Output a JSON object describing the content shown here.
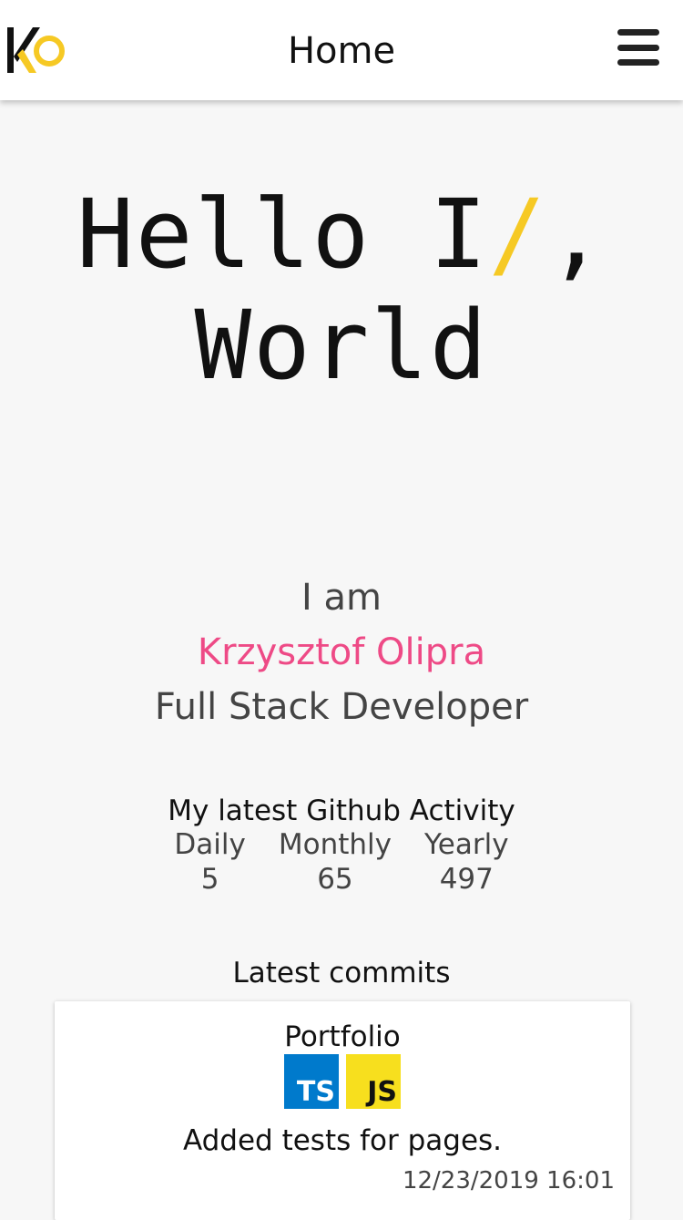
{
  "header": {
    "title": "Home",
    "logo_text": "KO",
    "menu_icon": "hamburger-menu-icon"
  },
  "hero": {
    "line1_before": "Hello I",
    "line1_accent": "/",
    "line1_after": ",",
    "line2": "World"
  },
  "intro": {
    "prefix": "I am",
    "name": "Krzysztof Olipra",
    "role": "Full Stack Developer"
  },
  "activity": {
    "title": "My latest Github Activity",
    "stats": [
      {
        "label": "Daily",
        "value": "5"
      },
      {
        "label": "Monthly",
        "value": "65"
      },
      {
        "label": "Yearly",
        "value": "497"
      }
    ]
  },
  "commits": {
    "title": "Latest commits",
    "items": [
      {
        "repo": "Portfolio",
        "languages": [
          "TS",
          "JS"
        ],
        "message": "Added tests for pages.",
        "date": "12/23/2019 16:01"
      }
    ]
  },
  "colors": {
    "accent_yellow": "#f6c924",
    "name_pink": "#ee4a86",
    "ts_blue": "#007acc",
    "js_yellow": "#f7df1e"
  }
}
